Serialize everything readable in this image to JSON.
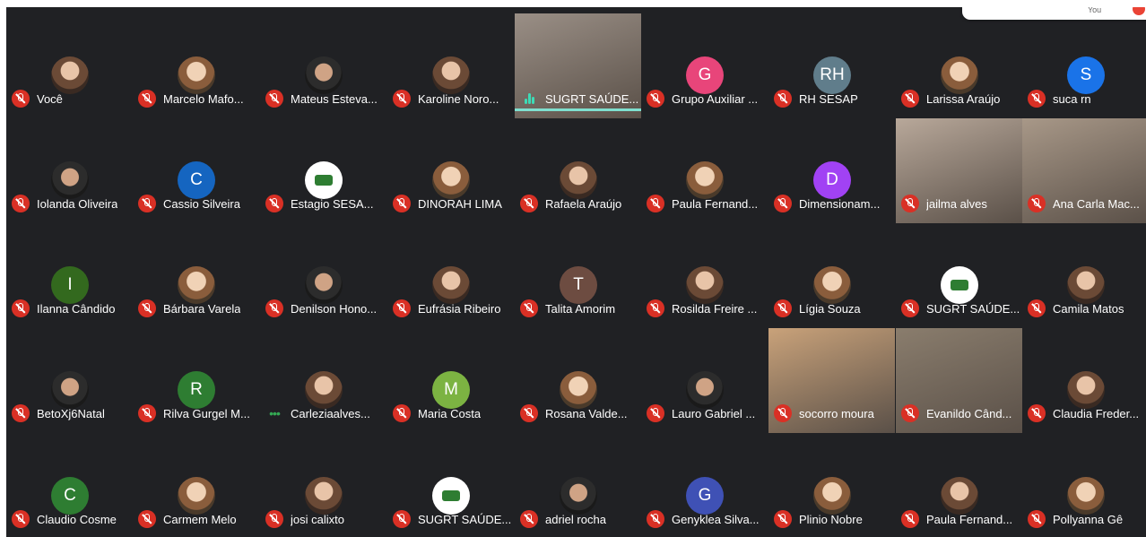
{
  "top_chip": {
    "text": "You"
  },
  "participants": [
    [
      {
        "name": "Você",
        "avatar": "photo",
        "muted": true
      },
      {
        "name": "Marcelo Mafo...",
        "avatar": "photo2",
        "muted": true
      },
      {
        "name": "Mateus Esteva...",
        "avatar": "photo3",
        "muted": true
      },
      {
        "name": "Karoline Noro...",
        "avatar": "photo",
        "muted": true
      },
      {
        "name": "SUGRT SAÚDE...",
        "avatar": "video",
        "muted": false,
        "speaking": true,
        "video_color": "#9a8f86"
      },
      {
        "name": "Grupo Auxiliar ...",
        "avatar": "letter",
        "letter": "G",
        "color": "#e8457a",
        "muted": true
      },
      {
        "name": "RH SESAP",
        "avatar": "letter",
        "letter": "RH",
        "color": "#607d8b",
        "muted": true
      },
      {
        "name": "Larissa Araújo",
        "avatar": "photo2",
        "muted": true
      },
      {
        "name": "suca rn",
        "avatar": "letter",
        "letter": "S",
        "color": "#1a73e8",
        "muted": true
      }
    ],
    [
      {
        "name": "Iolanda Oliveira",
        "avatar": "photo3",
        "muted": true
      },
      {
        "name": "Cassio Silveira",
        "avatar": "letter",
        "letter": "C",
        "color": "#1565c0",
        "muted": true
      },
      {
        "name": "Estagio SESA...",
        "avatar": "logo",
        "muted": true
      },
      {
        "name": "DINORAH LIMA",
        "avatar": "photo2",
        "muted": true
      },
      {
        "name": "Rafaela Araújo",
        "avatar": "photo",
        "muted": true
      },
      {
        "name": "Paula Fernand...",
        "avatar": "photo2",
        "muted": true
      },
      {
        "name": "Dimensionam...",
        "avatar": "letter",
        "letter": "D",
        "color": "#a142f4",
        "muted": true
      },
      {
        "name": "jailma alves",
        "avatar": "video",
        "muted": true,
        "video_color": "#b8a89a"
      },
      {
        "name": "Ana Carla Mac...",
        "avatar": "video",
        "muted": true,
        "video_color": "#a89888"
      }
    ],
    [
      {
        "name": "Ilanna Cândido",
        "avatar": "letter",
        "letter": "I",
        "color": "#33691e",
        "muted": true
      },
      {
        "name": "Bárbara Varela",
        "avatar": "photo2",
        "muted": true
      },
      {
        "name": "Denilson Hono...",
        "avatar": "photo3",
        "muted": true
      },
      {
        "name": "Eufrásia Ribeiro",
        "avatar": "photo",
        "muted": true
      },
      {
        "name": "Talita Amorim",
        "avatar": "letter",
        "letter": "T",
        "color": "#6d4c41",
        "muted": true
      },
      {
        "name": "Rosilda Freire ...",
        "avatar": "photo",
        "muted": true
      },
      {
        "name": "Lígia Souza",
        "avatar": "photo2",
        "muted": true
      },
      {
        "name": "SUGRT SAÚDE...",
        "avatar": "logo",
        "muted": true
      },
      {
        "name": "Camila Matos",
        "avatar": "photo",
        "muted": true
      }
    ],
    [
      {
        "name": "BetoXj6Natal",
        "avatar": "photo3",
        "muted": true
      },
      {
        "name": "Rilva Gurgel M...",
        "avatar": "letter",
        "letter": "R",
        "color": "#2e7d32",
        "muted": true
      },
      {
        "name": "Carleziaalves...",
        "avatar": "photo",
        "muted": false,
        "dots": true
      },
      {
        "name": "Maria Costa",
        "avatar": "letter",
        "letter": "M",
        "color": "#7cb342",
        "muted": true
      },
      {
        "name": "Rosana Valde...",
        "avatar": "photo2",
        "muted": true
      },
      {
        "name": "Lauro Gabriel ...",
        "avatar": "photo3",
        "muted": true
      },
      {
        "name": "socorro moura",
        "avatar": "video",
        "muted": true,
        "video_color": "#c9a27a"
      },
      {
        "name": "Evanildo Când...",
        "avatar": "video",
        "muted": true,
        "video_color": "#8a7d6d"
      },
      {
        "name": "Claudia Freder...",
        "avatar": "photo",
        "muted": true
      }
    ],
    [
      {
        "name": "Claudio Cosme",
        "avatar": "letter",
        "letter": "C",
        "color": "#2e7d32",
        "muted": true
      },
      {
        "name": "Carmem Melo",
        "avatar": "photo2",
        "muted": true
      },
      {
        "name": "josi calixto",
        "avatar": "photo",
        "muted": true
      },
      {
        "name": "SUGRT SAÚDE...",
        "avatar": "logo",
        "muted": true
      },
      {
        "name": "adriel rocha",
        "avatar": "photo3",
        "muted": true
      },
      {
        "name": "Genyklea Silva...",
        "avatar": "letter",
        "letter": "G",
        "color": "#3f51b5",
        "muted": true
      },
      {
        "name": "Plinio Nobre",
        "avatar": "photo2",
        "muted": true
      },
      {
        "name": "Paula Fernand...",
        "avatar": "photo",
        "muted": true
      },
      {
        "name": "Pollyanna Gê",
        "avatar": "photo2",
        "muted": true
      }
    ]
  ]
}
